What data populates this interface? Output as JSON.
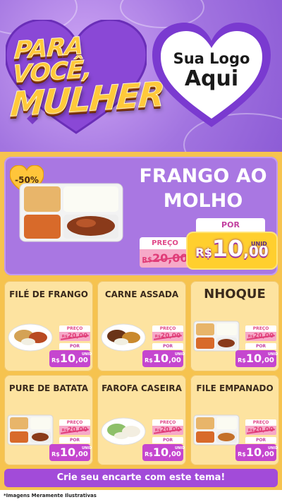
{
  "header": {
    "title_line1": "PARA VOCÊ,",
    "title_line2": "MULHER",
    "logo_line1": "Sua Logo",
    "logo_line2": "Aqui"
  },
  "feature": {
    "discount": "-50%",
    "name": "FRANGO AO MOLHO",
    "preco_label": "PREÇO",
    "old_currency": "R$",
    "old_value": "20,00",
    "por_label": "POR",
    "new_currency": "R$",
    "new_int": "10",
    "new_cents": ",00",
    "unit": "UNID"
  },
  "products": [
    {
      "name": "FILÉ DE FRANGO",
      "preco_label": "PREÇO",
      "old_currency": "R$",
      "old_value": "20,00",
      "por_label": "POR",
      "currency": "R$",
      "int": "10",
      "cents": ",00",
      "unit": "UNID",
      "icon": "plate-chicken-icon"
    },
    {
      "name": "CARNE ASSADA",
      "preco_label": "PREÇO",
      "old_currency": "R$",
      "old_value": "20,00",
      "por_label": "POR",
      "currency": "R$",
      "int": "10",
      "cents": ",00",
      "unit": "UNID",
      "icon": "plate-beef-icon"
    },
    {
      "name": "NHOQUE",
      "preco_label": "PREÇO",
      "old_currency": "R$",
      "old_value": "20,00",
      "por_label": "POR",
      "currency": "R$",
      "int": "10",
      "cents": ",00",
      "unit": "UNID",
      "icon": "tray-meal-icon"
    },
    {
      "name": "PURE DE BATATA",
      "preco_label": "PREÇO",
      "old_currency": "R$",
      "old_value": "20,00",
      "por_label": "POR",
      "currency": "R$",
      "int": "10",
      "cents": ",00",
      "unit": "UNID",
      "icon": "tray-meal-icon"
    },
    {
      "name": "FAROFA CASEIRA",
      "preco_label": "PREÇO",
      "old_currency": "R$",
      "old_value": "20,00",
      "por_label": "POR",
      "currency": "R$",
      "int": "10",
      "cents": ",00",
      "unit": "UNID",
      "icon": "bowl-rice-icon"
    },
    {
      "name": "FILE EMPANADO",
      "preco_label": "PREÇO",
      "old_currency": "R$",
      "old_value": "20,00",
      "por_label": "POR",
      "currency": "R$",
      "int": "10",
      "cents": ",00",
      "unit": "UNID",
      "icon": "tray-meal-icon"
    }
  ],
  "cta": "Crie seu encarte com este tema!",
  "disclaimer": "*Imagens Meramente Ilustrativas",
  "colors": {
    "purple": "#a977e2",
    "yellow": "#f6c34f",
    "pink": "#f6a9c8",
    "magenta": "#c546cf"
  }
}
